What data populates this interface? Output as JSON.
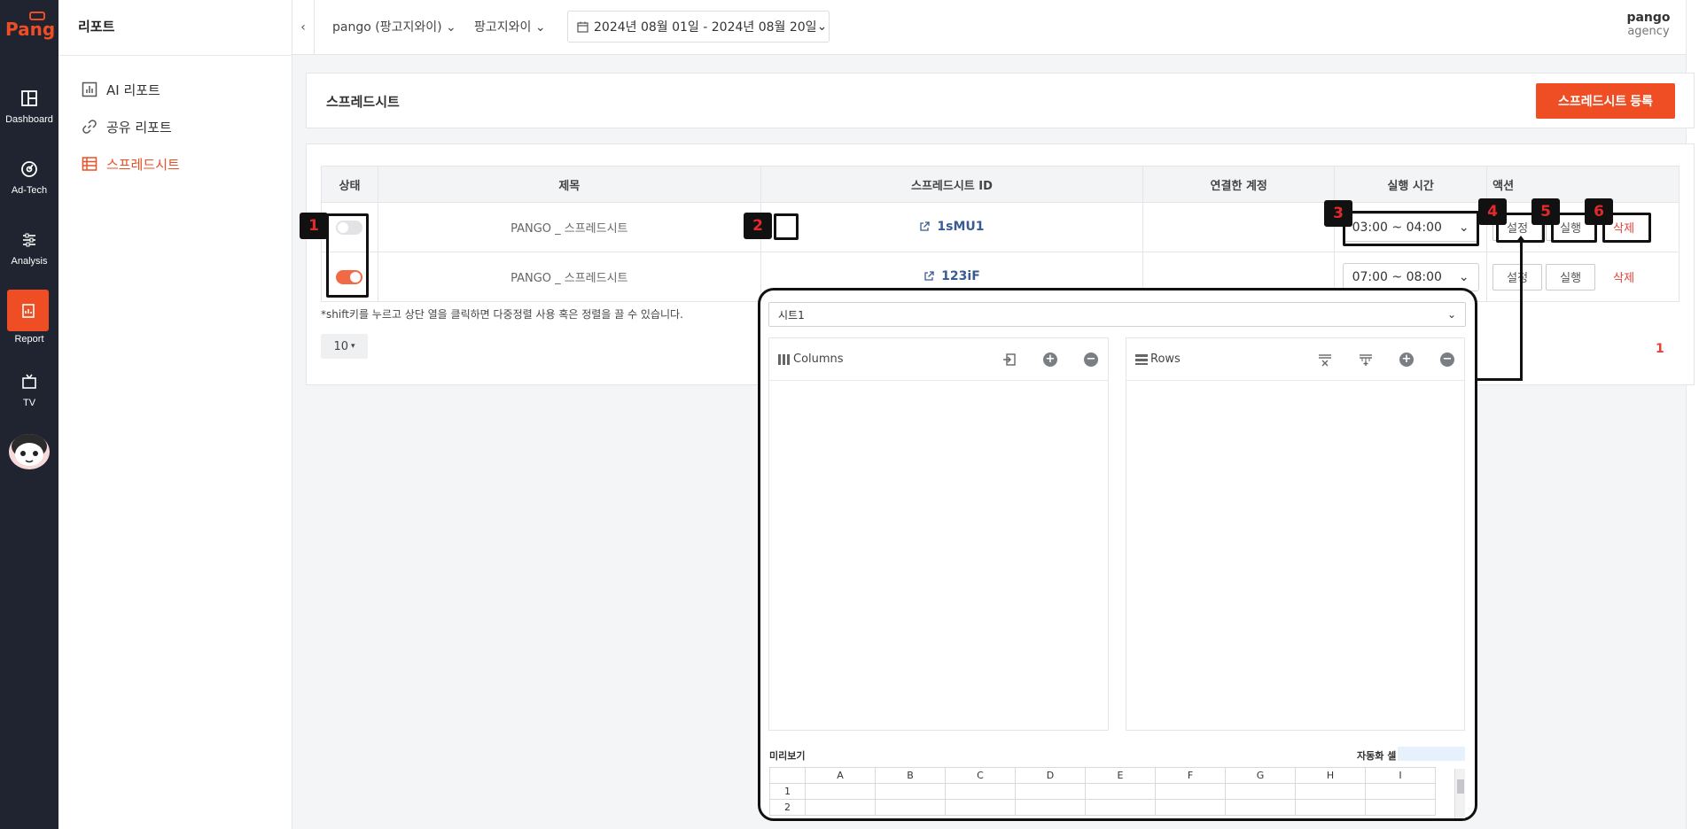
{
  "rail": {
    "items": [
      {
        "label": "Dashboard",
        "icon": "dashboard-icon"
      },
      {
        "label": "Ad-Tech",
        "icon": "adtech-icon"
      },
      {
        "label": "Analysis",
        "icon": "sliders-icon"
      },
      {
        "label": "Report",
        "icon": "report-icon"
      },
      {
        "label": "TV",
        "icon": "tv-icon"
      }
    ]
  },
  "sidebar": {
    "title": "리포트",
    "items": [
      {
        "label": "AI 리포트",
        "icon": "chart-icon"
      },
      {
        "label": "공유 리포트",
        "icon": "link-icon"
      },
      {
        "label": "스프레드시트",
        "icon": "table-icon"
      }
    ]
  },
  "topbar": {
    "account": "pango (팡고지와이)",
    "agency": "팡고지와이",
    "date_range": "2024년 08월 01일 - 2024년 08월 20일",
    "user_name": "pango",
    "user_role": "agency"
  },
  "header": {
    "title": "스프레드시트",
    "register_label": "스프레드시트 등록"
  },
  "table": {
    "columns": [
      "상태",
      "제목",
      "스프레드시트 ID",
      "연결한 계정",
      "실행 시간",
      "액션"
    ],
    "rows": [
      {
        "status_on": false,
        "title": "PANGO _ 스프레드시트",
        "sheet_id": "1sMU1",
        "account": "",
        "time": "03:00 ~ 04:00",
        "settings": "설정",
        "run": "실행",
        "delete": "삭제"
      },
      {
        "status_on": true,
        "title": "PANGO _ 스프레드시트",
        "sheet_id": "123iF",
        "account": "",
        "time": "07:00 ~ 08:00",
        "settings": "설정",
        "run": "실행",
        "delete": "삭제"
      }
    ],
    "note": "*shift키를 누르고 상단 열을 클릭하면 다중정렬 사용 혹은 정렬을 끌 수 있습니다.",
    "page_size": "10",
    "page": "1"
  },
  "annotations": [
    "1",
    "2",
    "3",
    "4",
    "5",
    "6"
  ],
  "popup": {
    "sheet": "시트1",
    "columns_label": "Columns",
    "rows_label": "Rows",
    "preview_label": "미리보기",
    "auto_cell_label": "자동화 셀",
    "grid_cols": [
      "A",
      "B",
      "C",
      "D",
      "E",
      "F",
      "G",
      "H",
      "I"
    ],
    "grid_rows": [
      "1",
      "2"
    ]
  },
  "colors": {
    "accent": "#ef4d23",
    "rail": "#1f2430",
    "link": "#3a5a92",
    "delete": "#e0433a"
  }
}
